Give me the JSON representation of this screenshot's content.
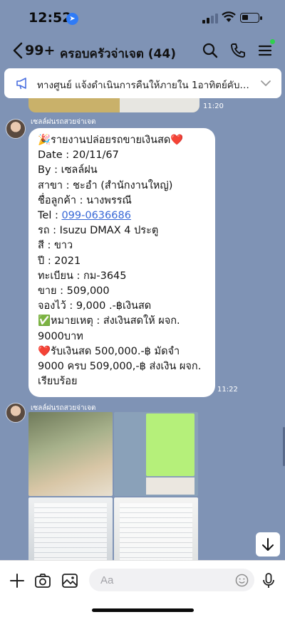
{
  "status_bar": {
    "time": "12:52"
  },
  "header": {
    "unread_count": "99+",
    "title": "ครอบครัวจ่าเจต (44)",
    "icons": [
      "back-chevron-icon",
      "search-icon",
      "phone-icon",
      "menu-icon"
    ]
  },
  "announcement": {
    "text": "ทางศูนย์ แจ้งดำเนินการคืนให้ภายใน 1อาทิตย์คับ @J..."
  },
  "messages": [
    {
      "time": "11:20"
    },
    {
      "sender": "เซลล์ฝนรถสวยจ่าเจต",
      "lines": [
        "🎉รายงานปล่อยรถขายเงินสด❤️",
        "Date : 20/11/67",
        "By : เซลล์ฝน",
        "สาขา : ชะอำ (สำนักงานใหญ่)",
        "ชื่อลูกค้า : นางพรรณี",
        "Tel : ",
        "รถ : Isuzu DMAX 4 ประตู",
        "สี : ขาว",
        "ปี : 2021",
        "ทะเบียน : กม-3645",
        "ขาย : 509,000",
        "จองไว้ : 9,000 .-฿เงินสด",
        "✅หมายเหตุ : ส่งเงินสดให้ ผจก.",
        "9000บาท",
        "❤️รับเงินสด 500,000.-฿ มัดจำ",
        "9000 ครบ 509,000,-฿ ส่งเงิน ผจก.",
        "เรียบร้อย"
      ],
      "phone_link": "099-0636686",
      "time": "11:22"
    },
    {
      "sender": "เซลล์ฝนรถสวยจ่าเจต",
      "type": "photo-grid",
      "photo_count": 4
    }
  ],
  "input_bar": {
    "placeholder": "Aa"
  },
  "colors": {
    "chat_bg": "#7f93b5",
    "link": "#3566d6",
    "bubble": "#ffffff",
    "online_dot": "#2fd04d"
  }
}
